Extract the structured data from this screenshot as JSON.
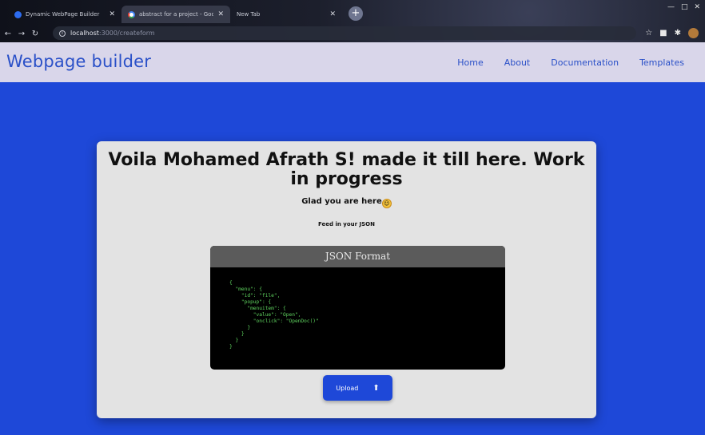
{
  "browser": {
    "tabs": [
      {
        "title": "Dynamic WebPage Builder"
      },
      {
        "title": "abstract for a project - Google Se"
      },
      {
        "title": "New Tab"
      }
    ],
    "new_tab_icon": "plus",
    "url_host": "localhost",
    "url_path": ":3000/createform",
    "nav_icons": {
      "back": "←",
      "forward": "→",
      "reload": "↻",
      "info": "i"
    },
    "toolbar_icons": {
      "star": "☆",
      "ext": "■",
      "puzzle": "✱"
    },
    "window_controls": {
      "minimize": "—",
      "maximize": "□",
      "close": "✕"
    }
  },
  "app": {
    "brand": "Webpage builder",
    "nav": [
      "Home",
      "About",
      "Documentation",
      "Templates"
    ],
    "headline": "Voila Mohamed Afrath S! made it till here. Work in progress",
    "glad_text": "Glad you are here",
    "emoji": "☺",
    "feed_text": "Feed in your JSON",
    "json_title": "JSON Format",
    "json_sample": "{\n  \"menu\": {\n    \"id\": \"file\",\n    \"popup\": {\n      \"menuitem\": {\n        \"value\": \"Open\",\n        \"onclick\": \"OpenDoc()\"\n      }\n    }\n  }\n}",
    "upload_label": "Upload",
    "upload_icon": "⬆"
  },
  "colors": {
    "accent": "#1e48d8",
    "header_bg": "#d9d6ea",
    "brand_text": "#2a50c8",
    "json_text": "#5fd45f"
  }
}
